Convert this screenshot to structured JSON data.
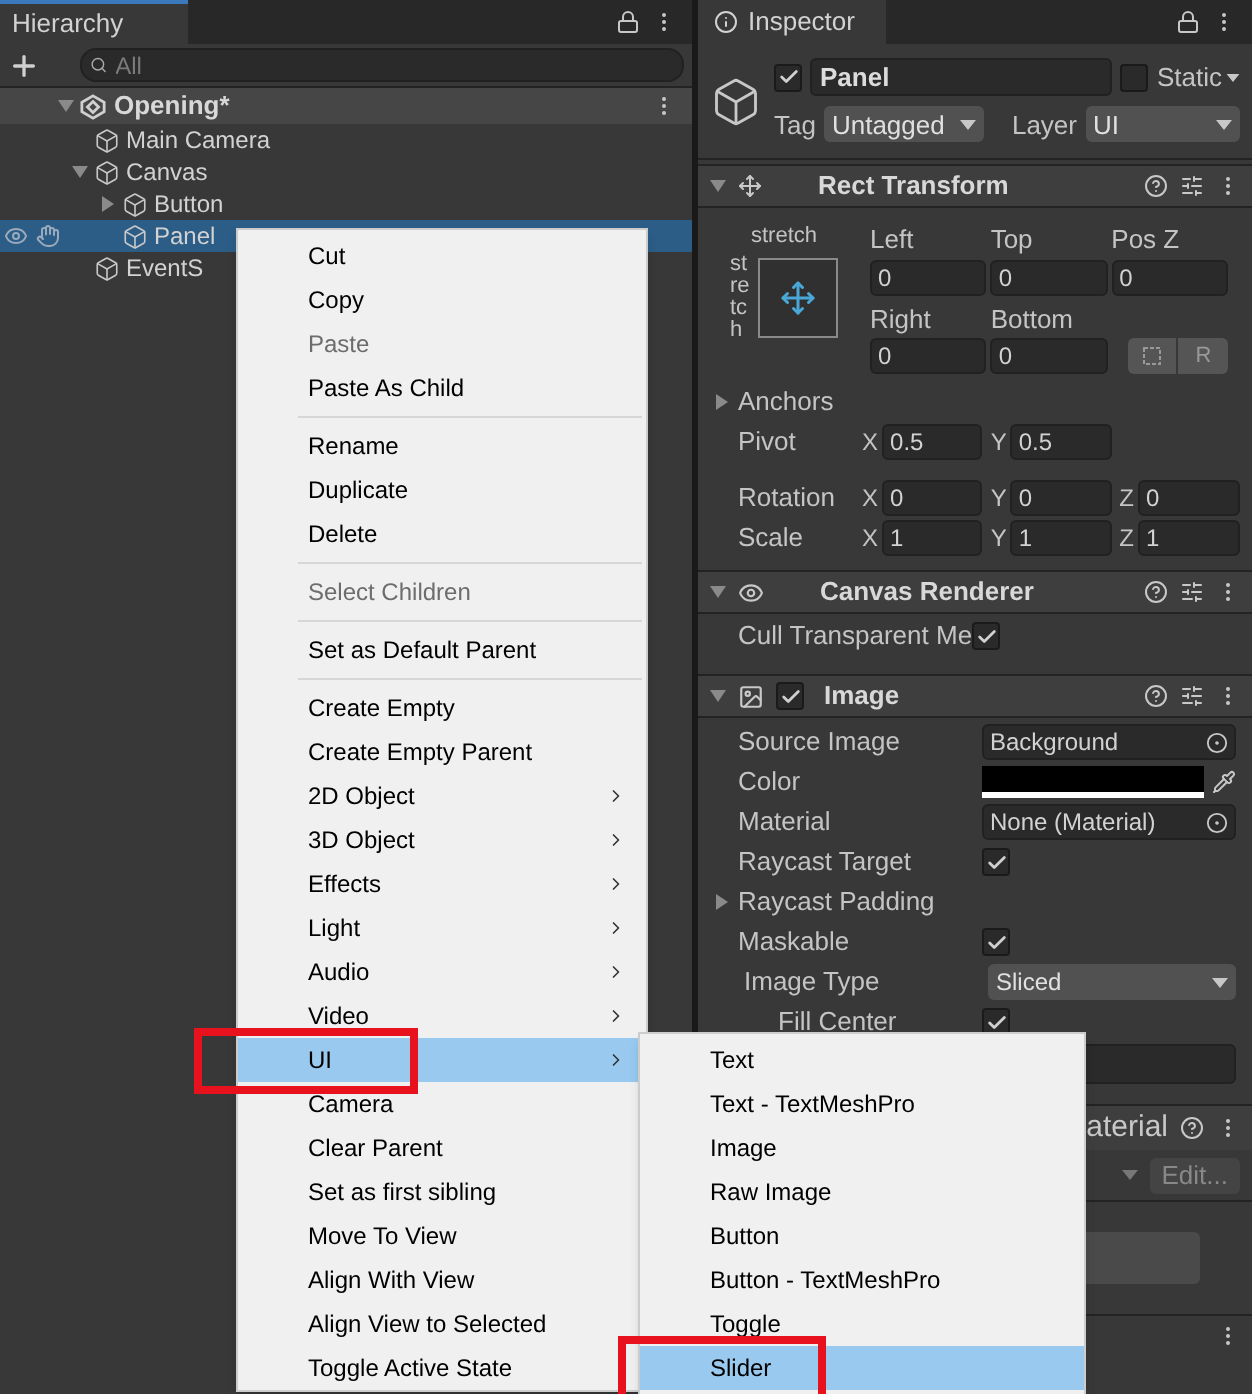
{
  "hierarchy": {
    "tab": "Hierarchy",
    "search_placeholder": "All",
    "scene": {
      "name": "Opening*",
      "expanded": true
    },
    "items": [
      {
        "name": "Main Camera",
        "selected": false
      },
      {
        "name": "Canvas",
        "expanded": true,
        "selected": false,
        "children": [
          {
            "name": "Button",
            "expanded": false,
            "selected": false
          },
          {
            "name": "Panel",
            "selected": true
          }
        ]
      },
      {
        "name": "EventS",
        "selected": false
      }
    ]
  },
  "inspector": {
    "tab": "Inspector",
    "object": {
      "active": true,
      "name": "Panel",
      "static": false,
      "static_label": "Static",
      "tag_label": "Tag",
      "tag": "Untagged",
      "layer_label": "Layer",
      "layer": "UI"
    },
    "rect_transform": {
      "title": "Rect Transform",
      "expanded": true,
      "preset_h": "stretch",
      "preset_v": "stretch",
      "fields": [
        {
          "label": "Left",
          "value": "0"
        },
        {
          "label": "Top",
          "value": "0"
        },
        {
          "label": "Pos Z",
          "value": "0"
        },
        {
          "label": "Right",
          "value": "0"
        },
        {
          "label": "Bottom",
          "value": "0"
        }
      ],
      "reset": "R",
      "anchors": {
        "label": "Anchors",
        "expanded": false
      },
      "vectors": [
        {
          "label": "Pivot",
          "axes": [
            {
              "axis": "X",
              "value": "0.5"
            },
            {
              "axis": "Y",
              "value": "0.5"
            }
          ]
        },
        {
          "label": "Rotation",
          "axes": [
            {
              "axis": "X",
              "value": "0"
            },
            {
              "axis": "Y",
              "value": "0"
            },
            {
              "axis": "Z",
              "value": "0"
            }
          ]
        },
        {
          "label": "Scale",
          "axes": [
            {
              "axis": "X",
              "value": "1"
            },
            {
              "axis": "Y",
              "value": "1"
            },
            {
              "axis": "Z",
              "value": "1"
            }
          ]
        }
      ]
    },
    "canvas_renderer": {
      "title": "Canvas Renderer",
      "expanded": true,
      "rows": [
        {
          "label": "Cull Transparent Me",
          "checked": true
        }
      ]
    },
    "image": {
      "title": "Image",
      "expanded": true,
      "enabled": true,
      "rows": [
        {
          "kind": "object",
          "label": "Source Image",
          "value": "Background"
        },
        {
          "kind": "color",
          "label": "Color"
        },
        {
          "kind": "object",
          "label": "Material",
          "value": "None (Material)"
        },
        {
          "kind": "check",
          "label": "Raycast Target",
          "checked": true
        },
        {
          "kind": "foldout",
          "label": "Raycast Padding",
          "expanded": false
        },
        {
          "kind": "check",
          "label": "Maskable",
          "checked": true
        },
        {
          "kind": "dropdown",
          "label": "Image Type",
          "value": "Sliced",
          "children": [
            {
              "kind": "check",
              "label": "Fill Center",
              "checked": true
            }
          ]
        },
        {
          "kind": "field"
        }
      ]
    },
    "material": {
      "title": "aterial",
      "edit": "Edit..."
    }
  },
  "context_menu": {
    "items": [
      {
        "kind": "item",
        "label": "Cut",
        "disabled": false,
        "selected": false
      },
      {
        "kind": "item",
        "label": "Copy",
        "disabled": false,
        "selected": false
      },
      {
        "kind": "item",
        "label": "Paste",
        "disabled": true,
        "selected": false
      },
      {
        "kind": "item",
        "label": "Paste As Child",
        "disabled": false,
        "selected": false
      },
      {
        "kind": "separator"
      },
      {
        "kind": "item",
        "label": "Rename",
        "disabled": false,
        "selected": false
      },
      {
        "kind": "item",
        "label": "Duplicate",
        "disabled": false,
        "selected": false
      },
      {
        "kind": "item",
        "label": "Delete",
        "disabled": false,
        "selected": false
      },
      {
        "kind": "separator"
      },
      {
        "kind": "item",
        "label": "Select Children",
        "disabled": true,
        "selected": false
      },
      {
        "kind": "separator"
      },
      {
        "kind": "item",
        "label": "Set as Default Parent",
        "disabled": false,
        "selected": false
      },
      {
        "kind": "separator"
      },
      {
        "kind": "item",
        "label": "Create Empty",
        "disabled": false,
        "selected": false
      },
      {
        "kind": "item",
        "label": "Create Empty Parent",
        "disabled": false,
        "selected": false
      },
      {
        "kind": "item",
        "label": "2D Object",
        "disabled": false,
        "selected": false,
        "submenu": true
      },
      {
        "kind": "item",
        "label": "3D Object",
        "disabled": false,
        "selected": false,
        "submenu": true
      },
      {
        "kind": "item",
        "label": "Effects",
        "disabled": false,
        "selected": false,
        "submenu": true
      },
      {
        "kind": "item",
        "label": "Light",
        "disabled": false,
        "selected": false,
        "submenu": true
      },
      {
        "kind": "item",
        "label": "Audio",
        "disabled": false,
        "selected": false,
        "submenu": true
      },
      {
        "kind": "item",
        "label": "Video",
        "disabled": false,
        "selected": false,
        "submenu": true
      },
      {
        "kind": "item",
        "label": "UI",
        "disabled": false,
        "selected": true,
        "submenu": true,
        "highlighted": true
      },
      {
        "kind": "item",
        "label": "Camera",
        "disabled": false,
        "selected": false
      },
      {
        "kind": "item",
        "label": "Clear Parent",
        "disabled": false,
        "selected": false
      },
      {
        "kind": "item",
        "label": "Set as first sibling",
        "disabled": false,
        "selected": false
      },
      {
        "kind": "item",
        "label": "Move To View",
        "disabled": false,
        "selected": false
      },
      {
        "kind": "item",
        "label": "Align With View",
        "disabled": false,
        "selected": false
      },
      {
        "kind": "item",
        "label": "Align View to Selected",
        "disabled": false,
        "selected": false
      },
      {
        "kind": "item",
        "label": "Toggle Active State",
        "disabled": false,
        "selected": false
      }
    ]
  },
  "submenu": {
    "items": [
      {
        "label": "Text",
        "selected": false
      },
      {
        "label": "Text - TextMeshPro",
        "selected": false
      },
      {
        "label": "Image",
        "selected": false
      },
      {
        "label": "Raw Image",
        "selected": false
      },
      {
        "label": "Button",
        "selected": false
      },
      {
        "label": "Button - TextMeshPro",
        "selected": false
      },
      {
        "label": "Toggle",
        "selected": false
      },
      {
        "label": "Slider",
        "selected": true,
        "highlighted": true
      }
    ]
  }
}
